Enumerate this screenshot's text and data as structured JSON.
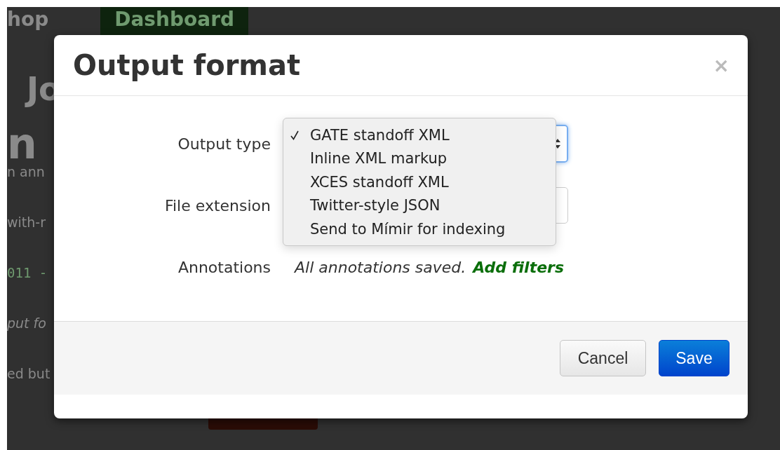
{
  "background_page": {
    "nav": [
      {
        "label": "hop",
        "selected": false
      },
      {
        "label": "Dashboard",
        "selected": true
      }
    ],
    "heading": "Jo",
    "subheading": "n",
    "lines": [
      {
        "text": "n ann",
        "kind": "plain"
      },
      {
        "text": "with-r",
        "kind": "plain"
      },
      {
        "text": "011 -",
        "kind": "code"
      },
      {
        "text": "put fo",
        "kind": "italic"
      },
      {
        "text": "ed but",
        "kind": "plain"
      }
    ]
  },
  "dialog": {
    "title": "Output format",
    "close": "×",
    "fields": [
      {
        "label": "Output type",
        "kind": "select"
      },
      {
        "label": "File extension",
        "kind": "text"
      },
      {
        "label": "Annotations",
        "kind": "note",
        "note": "All annotations saved.",
        "link": "Add filters"
      }
    ],
    "menu": [
      {
        "label": "GATE standoff XML",
        "selected": true
      },
      {
        "label": "Inline XML markup",
        "selected": false
      },
      {
        "label": "XCES standoff XML",
        "selected": false
      },
      {
        "label": "Twitter-style JSON",
        "selected": false
      },
      {
        "label": "Send to Mímir for indexing",
        "selected": false
      }
    ],
    "buttons": [
      {
        "label": "Cancel",
        "kind": "default"
      },
      {
        "label": "Save",
        "kind": "primary"
      }
    ]
  }
}
